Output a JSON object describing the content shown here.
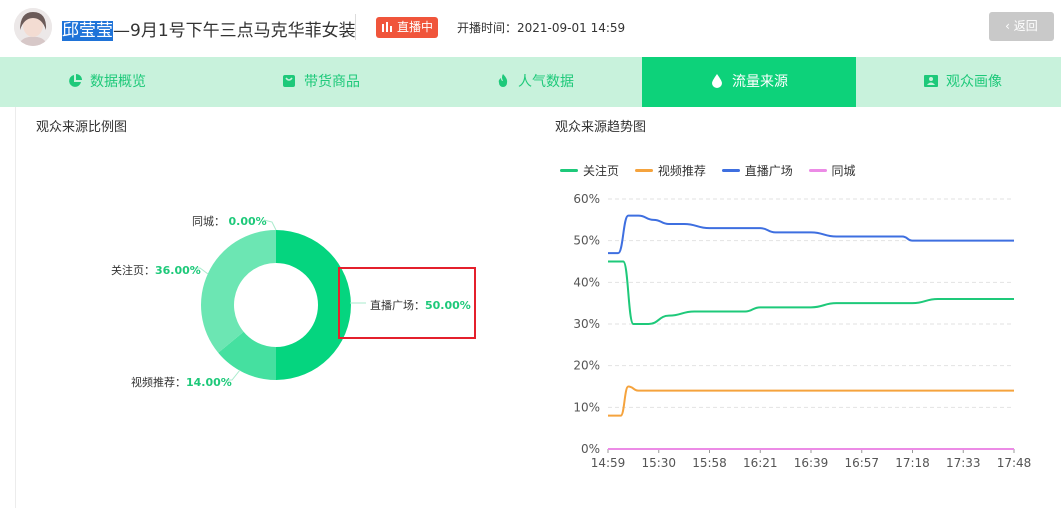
{
  "header": {
    "name_highlight": "邱莹莹",
    "title_rest": "—9月1号下午三点马克华菲女装",
    "live_badge": "直播中",
    "start_time_label": "开播时间：",
    "start_time": "2021-09-01 14:59",
    "back_label": "返回"
  },
  "tabs": [
    {
      "label": "数据概览",
      "icon": "pie-icon"
    },
    {
      "label": "带货商品",
      "icon": "bag-icon"
    },
    {
      "label": "人气数据",
      "icon": "flame-icon"
    },
    {
      "label": "流量来源",
      "icon": "drop-icon",
      "active": true
    },
    {
      "label": "观众画像",
      "icon": "portrait-icon"
    }
  ],
  "pie_section_title": "观众来源比例图",
  "trend_section_title": "观众来源趋势图",
  "colors": {
    "accent": "#0dd27a",
    "tab_bg": "#c8f2dc",
    "follow": "#1ec97a",
    "video": "#f5a33d",
    "live_square": "#3e6fe0",
    "same_city": "#ec8be6",
    "highlight_box": "#e4202c",
    "live_badge": "#f0553b"
  },
  "chart_data": [
    {
      "type": "pie",
      "title": "观众来源比例图",
      "slices": [
        {
          "name": "直播广场",
          "value": 50.0,
          "label": "50.00%",
          "color": "#05d57f"
        },
        {
          "name": "视频推荐",
          "value": 14.0,
          "label": "14.00%",
          "color": "#45e0a0"
        },
        {
          "name": "关注页",
          "value": 36.0,
          "label": "36.00%",
          "color": "#6ce6b3"
        },
        {
          "name": "同城",
          "value": 0.0,
          "label": "0.00%",
          "color": "#9aeecb"
        }
      ],
      "donut": true,
      "highlighted": "直播广场"
    },
    {
      "type": "line",
      "title": "观众来源趋势图",
      "categories": [
        "14:59",
        "15:30",
        "15:58",
        "16:21",
        "16:39",
        "16:57",
        "17:18",
        "17:33",
        "17:48"
      ],
      "y_ticks": [
        "0%",
        "10%",
        "20%",
        "30%",
        "40%",
        "50%",
        "60%"
      ],
      "ylim": [
        0,
        60
      ],
      "grid": true,
      "legend_position": "top-left",
      "series": [
        {
          "name": "关注页",
          "color": "#1ec97a",
          "x": [
            0,
            0.3,
            0.5,
            0.8,
            1.2,
            1.7,
            2.0,
            2.4,
            2.7,
            3.0,
            3.5,
            4.0,
            4.5,
            5.0,
            5.5,
            6.0,
            6.5,
            7.0,
            7.5,
            8.0
          ],
          "y": [
            45,
            45,
            30,
            30,
            32,
            33,
            33,
            33,
            33,
            34,
            34,
            34,
            35,
            35,
            35,
            35,
            36,
            36,
            36,
            36
          ]
        },
        {
          "name": "视频推荐",
          "color": "#f5a33d",
          "x": [
            0,
            0.25,
            0.4,
            0.6,
            1.0,
            2.0,
            3.0,
            4.0,
            5.0,
            6.0,
            7.0,
            8.0
          ],
          "y": [
            8,
            8,
            15,
            14,
            14,
            14,
            14,
            14,
            14,
            14,
            14,
            14
          ]
        },
        {
          "name": "直播广场",
          "color": "#3e6fe0",
          "x": [
            0,
            0.2,
            0.4,
            0.6,
            0.9,
            1.2,
            1.5,
            2.0,
            2.3,
            2.6,
            3.0,
            3.3,
            3.6,
            4.0,
            4.5,
            5.0,
            5.5,
            5.8,
            6.0,
            6.5,
            7.0,
            8.0
          ],
          "y": [
            47,
            47,
            56,
            56,
            55,
            54,
            54,
            53,
            53,
            53,
            53,
            52,
            52,
            52,
            51,
            51,
            51,
            51,
            50,
            50,
            50,
            50
          ]
        },
        {
          "name": "同城",
          "color": "#ec8be6",
          "x": [
            0,
            8
          ],
          "y": [
            0,
            0
          ]
        }
      ]
    }
  ]
}
